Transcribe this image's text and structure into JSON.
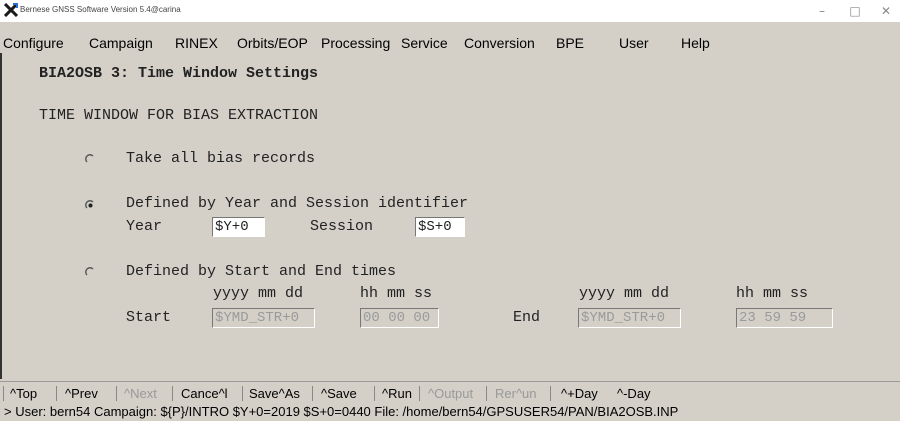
{
  "window": {
    "title": "Bernese GNSS Software Version 5.4@carina",
    "minimize_glyph": "–",
    "maximize_glyph": "□",
    "close_glyph": "✕",
    "app_icon": "x-logo-icon"
  },
  "menu": {
    "items": [
      "Configure",
      "Campaign",
      "RINEX",
      "Orbits/EOP",
      "Processing",
      "Service",
      "Conversion",
      "BPE",
      "User",
      "Help"
    ]
  },
  "panel": {
    "title": "BIA2OSB 3: Time Window Settings",
    "section": "TIME WINDOW FOR BIAS EXTRACTION",
    "options": {
      "all": {
        "label": "Take all bias records",
        "selected": false
      },
      "year_session": {
        "label": "Defined by Year and Session identifier",
        "selected": true,
        "year_label": "Year",
        "year_value": "$Y+0",
        "session_label": "Session",
        "session_value": "$S+0"
      },
      "start_end": {
        "label": "Defined by Start and End times",
        "selected": false,
        "date_header": "yyyy mm dd",
        "time_header": "hh mm ss",
        "start_label": "Start",
        "start_date": "$YMD_STR+0",
        "start_time": "00 00 00",
        "end_label": "End",
        "end_date": "$YMD_STR+0",
        "end_time": "23 59 59"
      }
    }
  },
  "buttons": {
    "top": "^Top",
    "prev": "^Prev",
    "next": "^Next",
    "cancel": "Cance^l",
    "save_as": "Save^As",
    "save": "^Save",
    "run": "^Run",
    "output": "^Output",
    "rerun": "Rer^un",
    "plus_day": "^+Day",
    "minus_day": "^-Day"
  },
  "status": {
    "line": "> User: bern54  Campaign: ${P}/INTRO  $Y+0=2019  $S+0=0440  File: /home/bern54/GPSUSER54/PAN/BIA2OSB.INP"
  },
  "colors": {
    "background": "#d4d0c8",
    "field_active": "#ffffff",
    "disabled_text": "#9a9a9a"
  }
}
